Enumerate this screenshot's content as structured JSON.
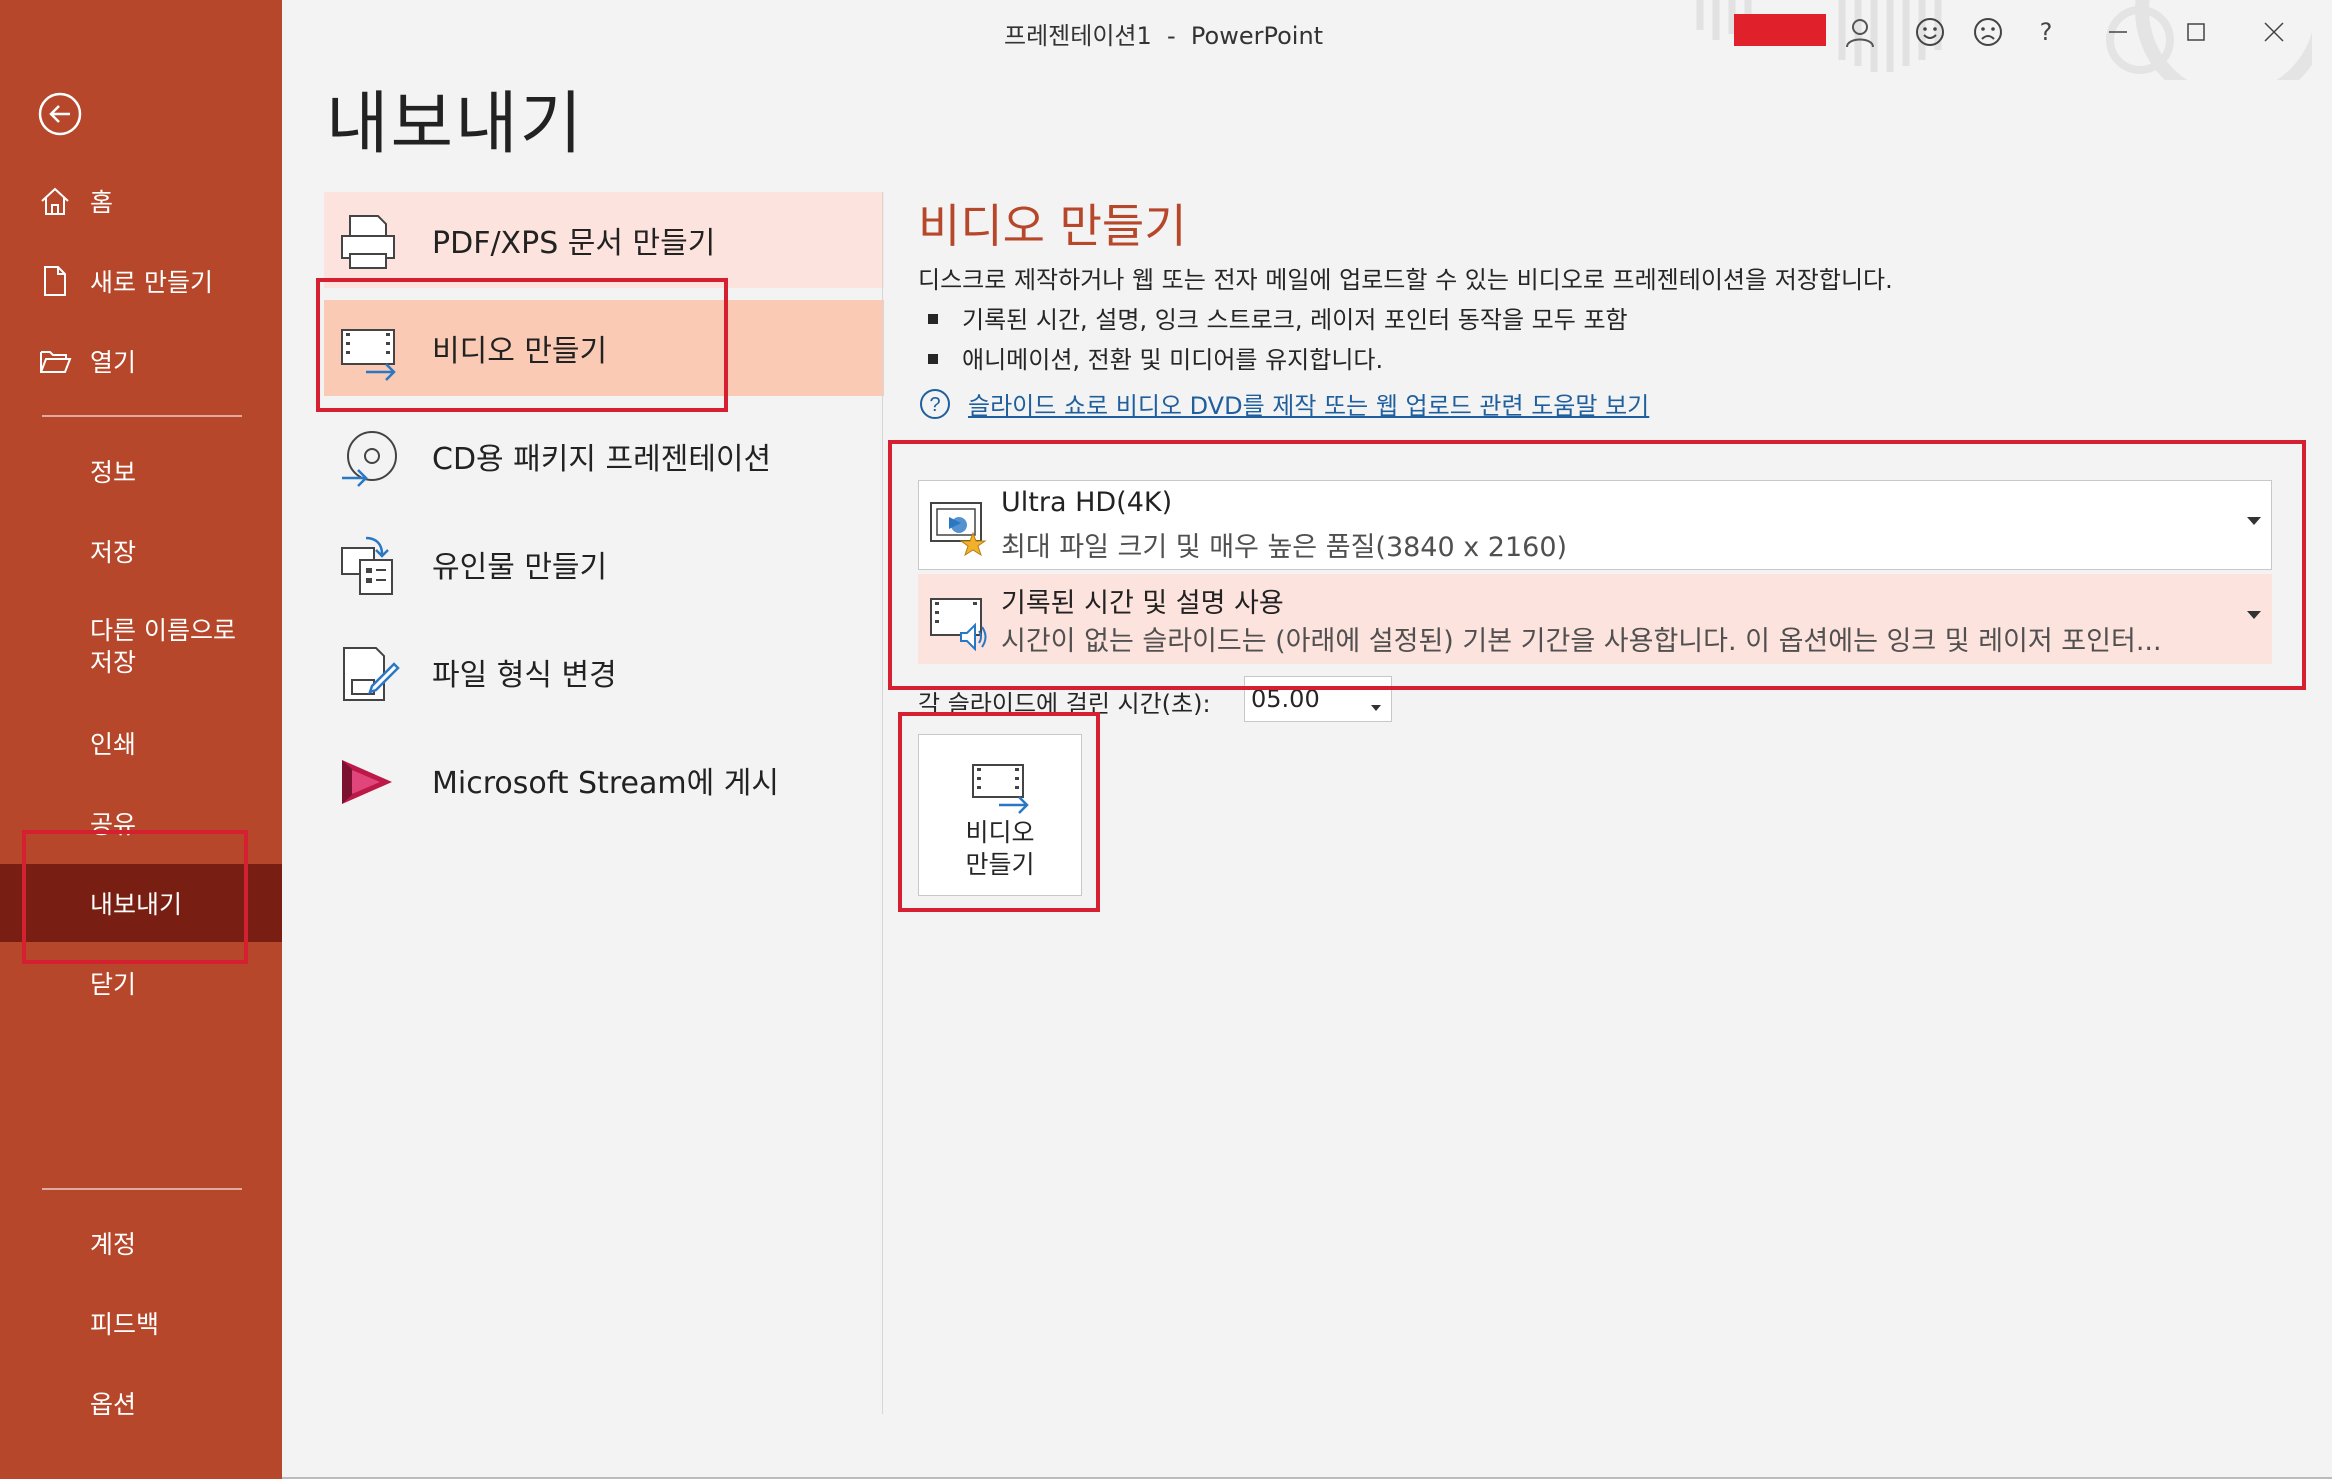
{
  "app": {
    "doc_title": "프레젠테이션1  -  PowerPoint",
    "accent_color": "#b7472a",
    "selected_nav_color": "#791e12"
  },
  "sidebar": {
    "back_icon": "arrow-left-circle-icon",
    "top_items": [
      {
        "label": "홈",
        "icon": "home-icon"
      },
      {
        "label": "새로 만들기",
        "icon": "new-document-icon"
      },
      {
        "label": "열기",
        "icon": "folder-open-icon"
      }
    ],
    "middle_items": [
      {
        "label": "정보"
      },
      {
        "label": "저장"
      },
      {
        "label_line1": "다른 이름으로",
        "label_line2": "저장"
      },
      {
        "label": "인쇄"
      },
      {
        "label": "공유"
      },
      {
        "label": "내보내기",
        "selected": true
      },
      {
        "label": "닫기"
      }
    ],
    "bottom_items": [
      {
        "label": "계정"
      },
      {
        "label": "피드백"
      },
      {
        "label": "옵션"
      }
    ]
  },
  "page": {
    "title": "내보내기"
  },
  "export_options": [
    {
      "label": "PDF/XPS 문서 만들기",
      "icon": "pdf-printer-icon"
    },
    {
      "label": "비디오 만들기",
      "icon": "video-film-icon",
      "selected": true
    },
    {
      "label": "CD용 패키지 프레젠테이션",
      "icon": "cd-package-icon"
    },
    {
      "label": "유인물 만들기",
      "icon": "handout-icon"
    },
    {
      "label": "파일 형식 변경",
      "icon": "file-type-change-icon"
    },
    {
      "label": "Microsoft Stream에 게시",
      "icon": "microsoft-stream-icon"
    }
  ],
  "video": {
    "title": "비디오 만들기",
    "description": "디스크로 제작하거나 웹 또는 전자 메일에 업로드할 수 있는 비디오로 프레젠테이션을 저장합니다.",
    "bullets": [
      "기록된 시간, 설명, 잉크 스트로크, 레이저 포인터 동작을 모두 포함",
      "애니메이션, 전환 및 미디어를 유지합니다."
    ],
    "help_link": "슬라이드 쇼로 비디오 DVD를 제작 또는 웹 업로드 관련 도움말 보기",
    "quality": {
      "title": "Ultra HD(4K)",
      "subtitle": "최대 파일 크기 및 매우 높은 품질(3840 x 2160)"
    },
    "timing": {
      "title": "기록된 시간 및 설명 사용",
      "subtitle": "시간이 없는 슬라이드는 (아래에 설정된) 기본 기간을 사용합니다. 이 옵션에는 잉크 및 레이저 포인터..."
    },
    "duration_label": "각 슬라이드에 걸린 시간(초):",
    "duration_value": "05.00",
    "button_line1": "비디오",
    "button_line2": "만들기"
  }
}
